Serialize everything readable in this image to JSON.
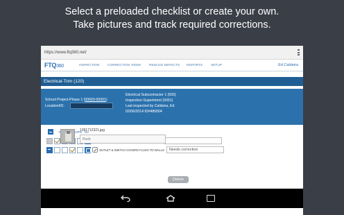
{
  "caption": {
    "line1": "Select a preloaded checklist or create your own.",
    "line2": "Take pictures and track required corrections."
  },
  "browser": {
    "url": "https://www.ftq360.net/"
  },
  "nav": {
    "logo_text": "FTQ",
    "logo_num": "360",
    "items": [
      "INSPECTION",
      "CORRECTION ITEMS",
      "REDUCE DEFECTS",
      "REPORTS",
      "SETUP"
    ],
    "user": "Ed Caldeira"
  },
  "title": "Electrical-Trim (120)",
  "info": {
    "project_label": "School Project-Phase 1 (",
    "project_link": "00003-00001",
    "project_close": ")",
    "location_label": "Location/ID:",
    "location_value": "",
    "right": [
      "Electrical Subcontractor 1 (593)",
      "Inspection-Superintent (5051)",
      "Last inspected by Caldeira, Ed",
      "02/06/2014 ID#480004"
    ]
  },
  "checklist": {
    "headers": [
      "FTQ",
      "CL",
      "OPN",
      "NA"
    ],
    "rows": [
      {
        "label": "OUTLET & SWITCH COVERS PLUMB & LEVEL",
        "note": "",
        "checked_col": 0
      },
      {
        "label": "OUTLET & SWITCH COVERS FLUSH TO WALLS",
        "note": "Needs correction",
        "checked_col": 2
      }
    ]
  },
  "attachment": {
    "filename": "1391712321.jpg",
    "priority": "Rush",
    "delete_label": "Delete"
  },
  "colors": {
    "background": "#3a3e47",
    "brand_blue": "#2a6db0",
    "title_bar": "#1f5e94",
    "info_bar": "#2b72ad"
  }
}
